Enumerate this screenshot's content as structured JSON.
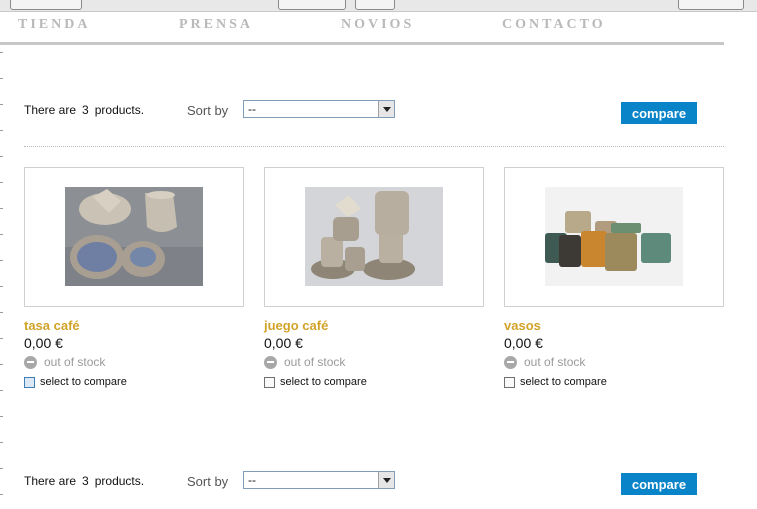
{
  "nav": {
    "items": [
      "TIENDA",
      "PRENSA",
      "NOVIOS",
      "CONTACTO"
    ]
  },
  "toolbar_top": {
    "count_prefix": "There are",
    "count": "3",
    "count_suffix": "products.",
    "sort_label": "Sort by",
    "sort_value": "--",
    "compare_label": "compare"
  },
  "toolbar_bottom": {
    "count_prefix": "There are",
    "count": "3",
    "count_suffix": "products.",
    "sort_label": "Sort by",
    "sort_value": "--",
    "compare_label": "compare"
  },
  "products": [
    {
      "name": "tasa café",
      "price": "0,00 €",
      "stock": "out of stock",
      "compare_label": "select to compare"
    },
    {
      "name": "juego café",
      "price": "0,00 €",
      "stock": "out of stock",
      "compare_label": "select to compare"
    },
    {
      "name": "vasos",
      "price": "0,00 €",
      "stock": "out of stock",
      "compare_label": "select to compare"
    }
  ],
  "colors": {
    "accent_button": "#0a84c9",
    "product_name": "#d2a32a",
    "nav_text": "#b9b9b9"
  },
  "icons": [
    "out-of-stock-icon",
    "dropdown-arrow-icon"
  ]
}
